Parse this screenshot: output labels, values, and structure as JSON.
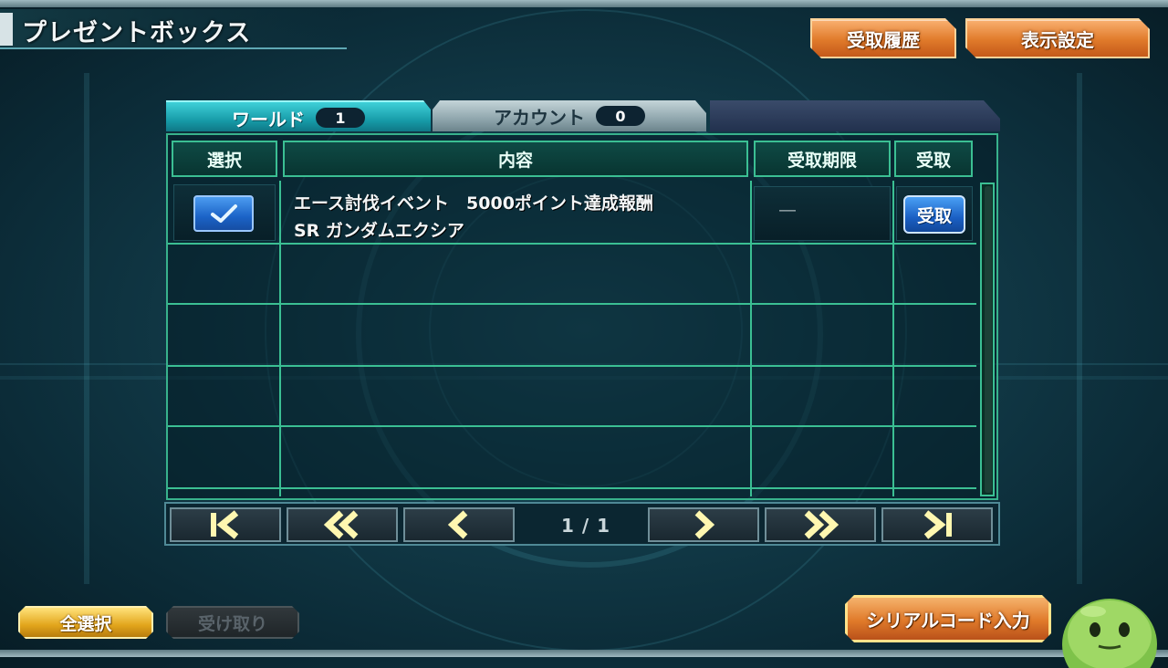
{
  "header": {
    "title": "プレゼントボックス",
    "history_button": "受取履歴",
    "display_settings_button": "表示設定"
  },
  "tabs": [
    {
      "label": "ワールド",
      "count": "1",
      "active": true
    },
    {
      "label": "アカウント",
      "count": "0",
      "active": false
    }
  ],
  "table": {
    "columns": [
      "選択",
      "内容",
      "受取期限",
      "受取"
    ],
    "rows": [
      {
        "selected": true,
        "content_line1": "エース討伐イベント　5000ポイント達成報酬",
        "content_line2": "SR ガンダムエクシア",
        "deadline": "―",
        "receive_label": "受取"
      }
    ]
  },
  "pagination": {
    "page_indicator": "1 / 1"
  },
  "footer": {
    "select_all_button": "全選択",
    "receive_button": "受け取り",
    "serial_code_button": "シリアルコード入力"
  },
  "colors": {
    "accent_orange": "#e07a2a",
    "grid_green": "#3bbf93",
    "tab_active": "#169aa7",
    "select_yellow": "#e2a51c"
  }
}
